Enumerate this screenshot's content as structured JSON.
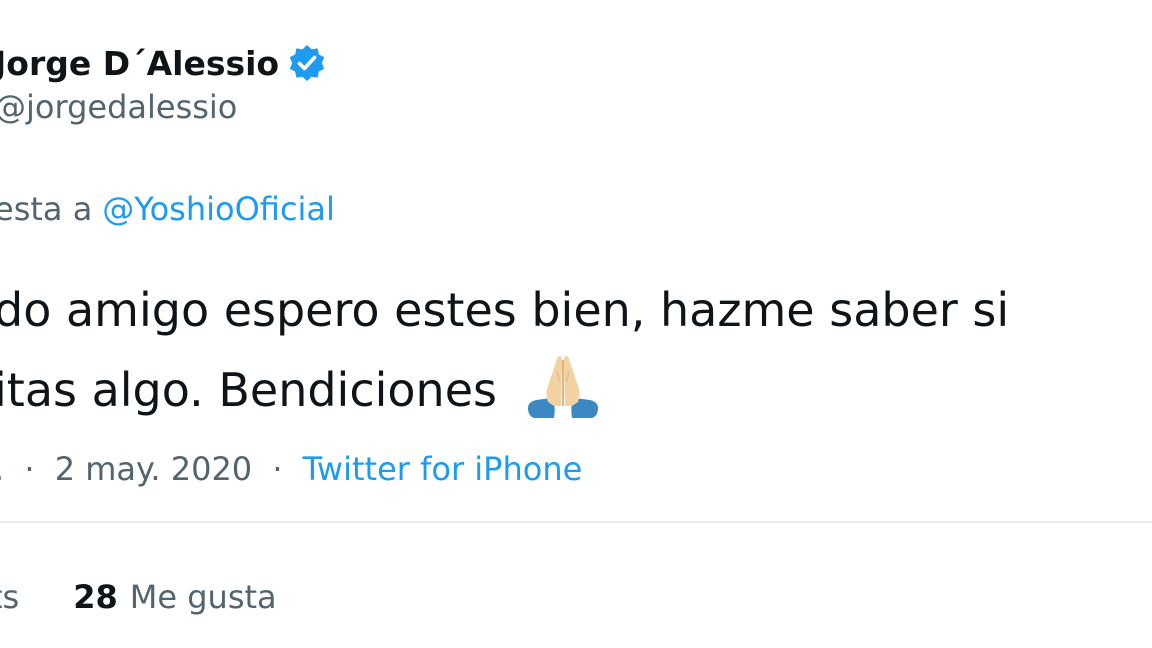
{
  "author": {
    "name": "Jorge D´Alessio",
    "handle": "@jorgedalessio"
  },
  "reply": {
    "prefix": "esta a",
    "mention": "@YoshioOficial"
  },
  "tweet": {
    "line1": "do amigo espero estes bien, hazme saber si",
    "line2": "itas algo. Bendiciones",
    "emoji": "folded-hands-emoji"
  },
  "meta": {
    "time_fragment": ".",
    "sep": "·",
    "date": "2 may. 2020",
    "source": "Twitter for iPhone"
  },
  "stats": {
    "retweets_fragment": "ts",
    "likes_count": "28",
    "likes_label": "Me gusta"
  },
  "colors": {
    "text": "#0f1419",
    "secondary": "#536471",
    "accent": "#1d9bf0",
    "divider": "#e6ecf0"
  }
}
